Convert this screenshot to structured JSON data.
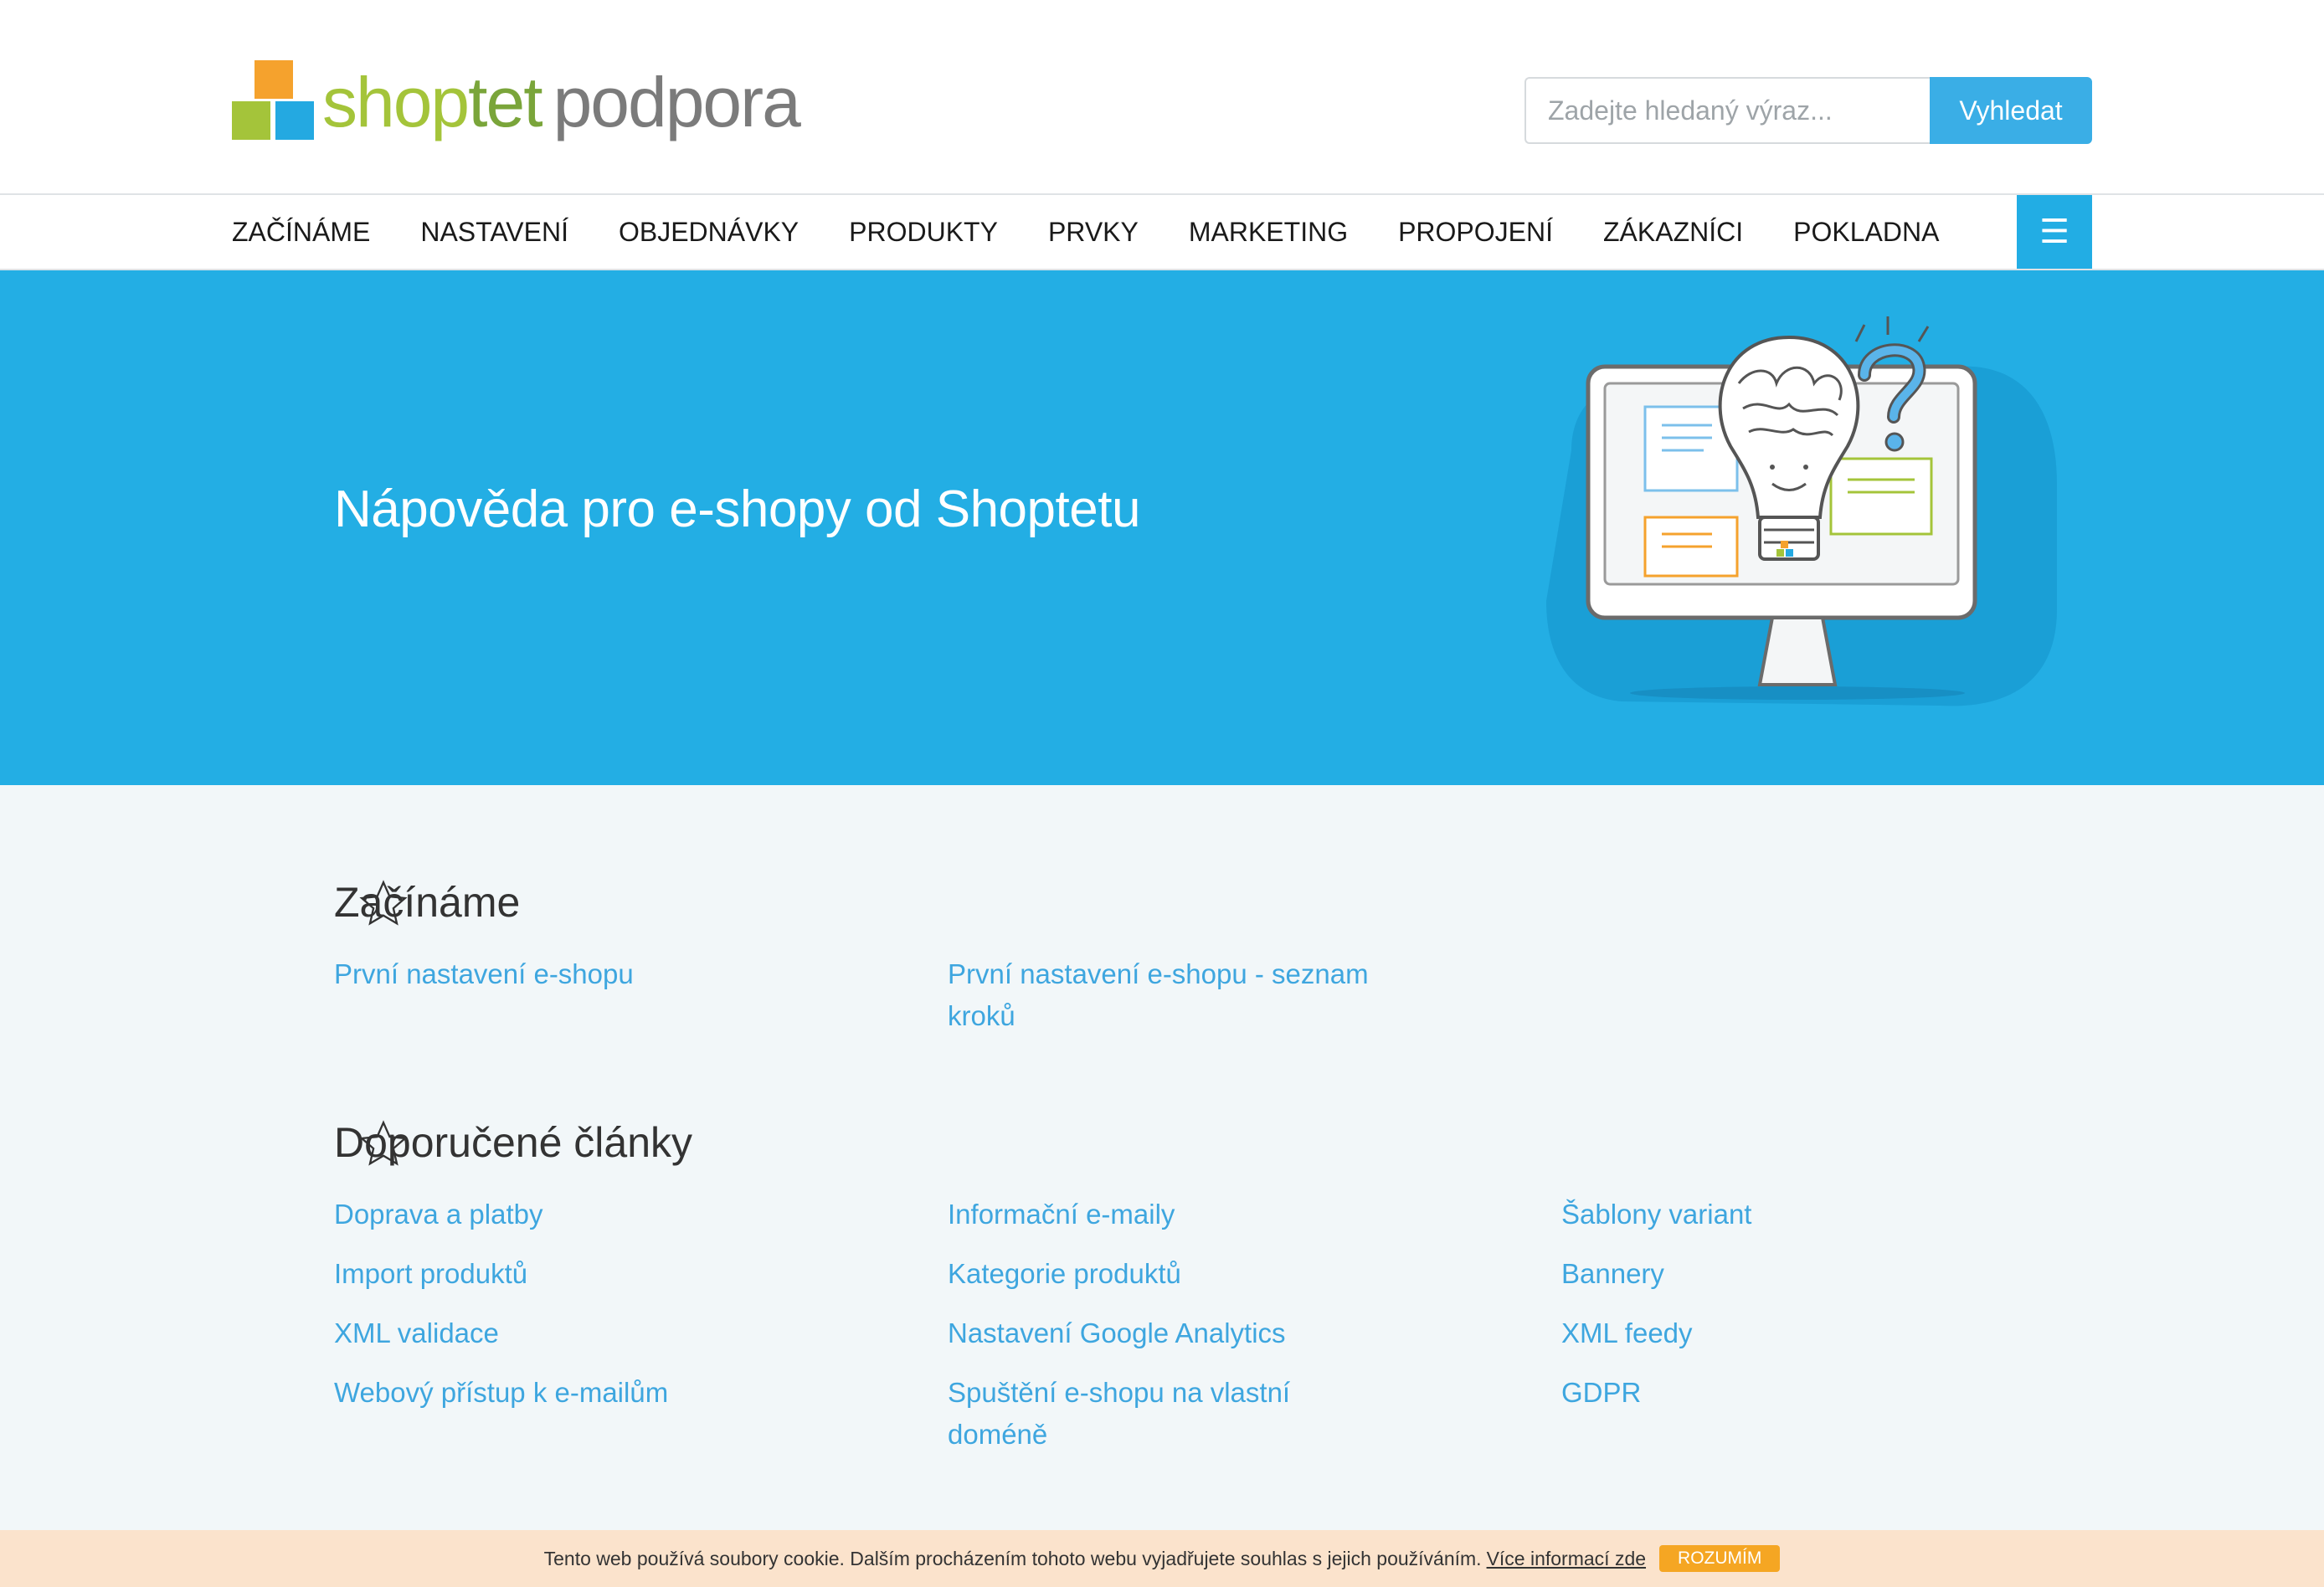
{
  "brand": {
    "logo_shop": "shop",
    "logo_tet": "tet",
    "logo_podpora": "podpora",
    "colors": {
      "orange": "#f5a22d",
      "green": "#a4c43a",
      "blue": "#24a9e1"
    }
  },
  "search": {
    "placeholder": "Zadejte hledaný výraz...",
    "button_label": "Vyhledat"
  },
  "nav": {
    "items": [
      "Začínáme",
      "Nastavení",
      "Objednávky",
      "Produkty",
      "Prvky",
      "Marketing",
      "Propojení",
      "Zákazníci",
      "Pokladna"
    ],
    "menu_icon": "☰"
  },
  "hero": {
    "title": "Nápověda pro e-shopy od Shoptetu"
  },
  "sections": [
    {
      "title": "Začínáme",
      "links": [
        "První nastavení e-shopu",
        "První nastavení e-shopu - seznam kroků"
      ]
    },
    {
      "title": "Doporučené články",
      "links": [
        "Doprava a platby",
        "Informační e-maily",
        "Šablony variant",
        "Import produktů",
        "Kategorie produktů",
        "Bannery",
        "XML validace",
        "Nastavení Google Analytics",
        "XML feedy",
        "Webový přístup k e-mailům",
        "Spuštění e-shopu na vlastní doméně",
        "GDPR"
      ]
    }
  ],
  "cookie": {
    "text": "Tento web používá soubory cookie. Dalším procházením tohoto webu vyjadřujete souhlas s jejich používáním.",
    "more_link": "Více informací zde",
    "accept": "Rozumím"
  }
}
